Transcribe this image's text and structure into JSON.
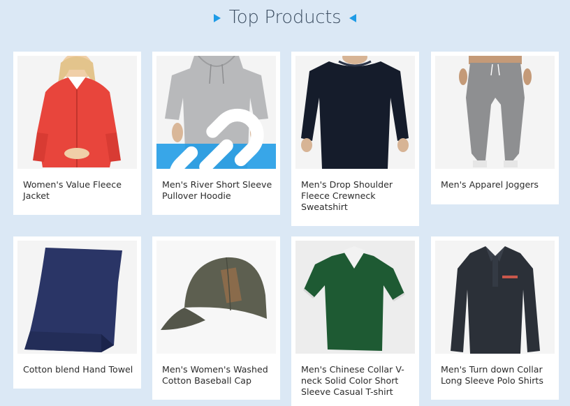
{
  "header": {
    "title": "Top Products"
  },
  "products": [
    {
      "name": "Women's Value Fleece Jacket",
      "image_icon": "red-fleece-jacket-image",
      "color": "#e8453c"
    },
    {
      "name": "Men's River Short Sleeve Pullover Hoodie",
      "image_icon": "grey-hoodie-image",
      "color": "#b8b9bb",
      "hover_icon": "link-icon"
    },
    {
      "name": "Men's Drop Shoulder Fleece Crewneck Sweatshirt",
      "image_icon": "navy-sweatshirt-image",
      "color": "#151c2b"
    },
    {
      "name": "Men's Apparel Joggers",
      "image_icon": "grey-joggers-image",
      "color": "#8e8f91"
    },
    {
      "name": "Cotton blend Hand Towel",
      "image_icon": "navy-towel-image",
      "color": "#2a3566"
    },
    {
      "name": "Men's Women's Washed Cotton Baseball Cap",
      "image_icon": "olive-cap-image",
      "color": "#5d5f50"
    },
    {
      "name": "Men's Chinese Collar V-neck Solid Color Short Sleeve Casual T-shirt",
      "image_icon": "green-tshirt-image",
      "color": "#1e5a33"
    },
    {
      "name": "Men's Turn down Collar Long Sleeve Polo Shirts",
      "image_icon": "dark-polo-shirt-image",
      "color": "#2b3038"
    }
  ],
  "colors": {
    "background": "#dbe8f5",
    "accent": "#1e9be6",
    "card": "#ffffff"
  }
}
